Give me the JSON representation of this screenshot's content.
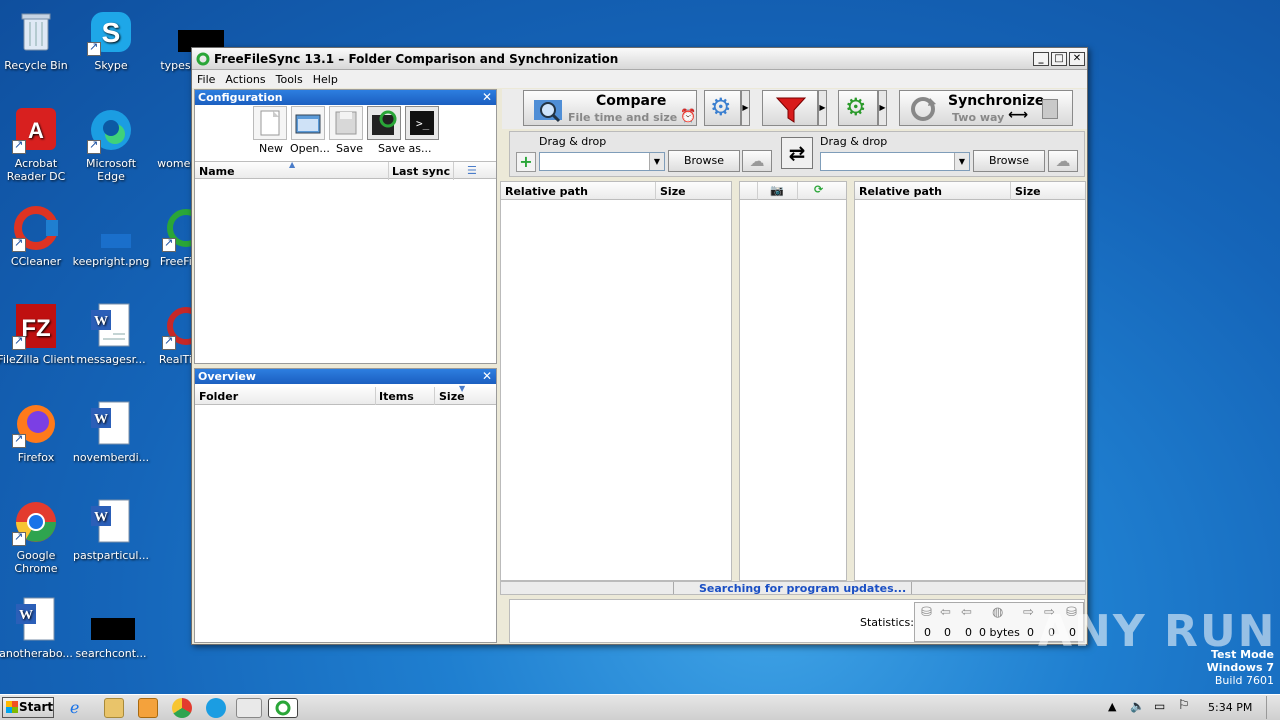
{
  "desktop": {
    "icons": [
      {
        "label": "Recycle Bin"
      },
      {
        "label": "Skype"
      },
      {
        "label": "typespr..."
      },
      {
        "label": "Acrobat Reader DC"
      },
      {
        "label": "Microsoft Edge"
      },
      {
        "label": "womenb..."
      },
      {
        "label": "CCleaner"
      },
      {
        "label": "keepright.png"
      },
      {
        "label": "FreeFile..."
      },
      {
        "label": "FileZilla Client"
      },
      {
        "label": "messagesr..."
      },
      {
        "label": "RealTim..."
      },
      {
        "label": "Firefox"
      },
      {
        "label": "novemberdi..."
      },
      {
        "label": "Google Chrome"
      },
      {
        "label": "pastparticul..."
      },
      {
        "label": "anotherabo..."
      },
      {
        "label": "searchcont..."
      }
    ]
  },
  "window": {
    "title": "FreeFileSync 13.1 – Folder Comparison and Synchronization",
    "menu": [
      "File",
      "Actions",
      "Tools",
      "Help"
    ],
    "config": {
      "header": "Configuration",
      "buttons": [
        "New",
        "Open...",
        "Save",
        "Save as..."
      ],
      "col_name": "Name",
      "col_last_sync": "Last sync"
    },
    "overview": {
      "header": "Overview",
      "col_folder": "Folder",
      "col_items": "Items",
      "col_size": "Size"
    },
    "compare": {
      "label": "Compare",
      "sub": "File time and size"
    },
    "sync": {
      "label": "Synchronize",
      "sub": "Two way"
    },
    "left_folder": {
      "caption": "Drag & drop",
      "browse": "Browse"
    },
    "right_folder": {
      "caption": "Drag & drop",
      "browse": "Browse"
    },
    "grid_left": {
      "col_path": "Relative path",
      "col_size": "Size"
    },
    "grid_right": {
      "col_path": "Relative path",
      "col_size": "Size"
    },
    "status": "Searching for program updates...",
    "statistics": {
      "label": "Statistics:",
      "values": [
        "0",
        "0",
        "0",
        "0 bytes",
        "0",
        "0",
        "0"
      ]
    }
  },
  "taskbar": {
    "start": "Start",
    "time": "5:34 PM"
  },
  "watermark": {
    "line1": "Test Mode",
    "line2": "Windows 7",
    "line3": "Build 7601",
    "brand": "ANY RUN"
  }
}
